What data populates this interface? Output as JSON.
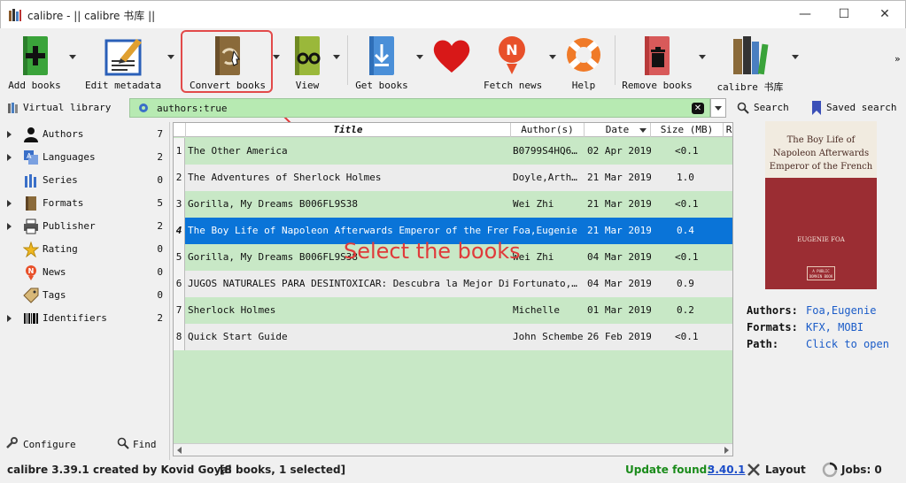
{
  "window": {
    "title": "calibre - || calibre 书库 ||",
    "minimize": "—",
    "maximize": "☐",
    "close": "✕"
  },
  "toolbar": {
    "add_books": "Add books",
    "edit_metadata": "Edit metadata",
    "convert_books": "Convert books",
    "view": "View",
    "get_books": "Get books",
    "fetch_news": "Fetch news",
    "help": "Help",
    "remove_books": "Remove books",
    "library": "calibre 书库",
    "more": "»"
  },
  "searchbar": {
    "virtual_library": "Virtual library",
    "query": "authors:true",
    "search": "Search",
    "saved_search": "Saved search"
  },
  "tag_browser": {
    "items": [
      {
        "label": "Authors",
        "count": "7",
        "expandable": true
      },
      {
        "label": "Languages",
        "count": "2",
        "expandable": true
      },
      {
        "label": "Series",
        "count": "0",
        "expandable": false
      },
      {
        "label": "Formats",
        "count": "5",
        "expandable": true
      },
      {
        "label": "Publisher",
        "count": "2",
        "expandable": true
      },
      {
        "label": "Rating",
        "count": "0",
        "expandable": false
      },
      {
        "label": "News",
        "count": "0",
        "expandable": false
      },
      {
        "label": "Tags",
        "count": "0",
        "expandable": false
      },
      {
        "label": "Identifiers",
        "count": "2",
        "expandable": true
      }
    ],
    "configure": "Configure",
    "find": "Find"
  },
  "book_table": {
    "columns": [
      "Title",
      "Author(s)",
      "Date",
      "Size (MB)",
      "R"
    ],
    "rows": [
      {
        "num": "1",
        "title": "The Other America",
        "author": "B0799S4HQ6…",
        "date": "02 Apr 2019",
        "size": "<0.1"
      },
      {
        "num": "2",
        "title": "The Adventures of Sherlock Holmes",
        "author": "Doyle,Arth…",
        "date": "21 Mar 2019",
        "size": "1.0"
      },
      {
        "num": "3",
        "title": "Gorilla, My Dreams B006FL9S38",
        "author": "Wei Zhi",
        "date": "21 Mar 2019",
        "size": "<0.1"
      },
      {
        "num": "4",
        "title": "The Boy Life of Napoleon Afterwards Emperor of the French",
        "author": "Foa,Eugenie",
        "date": "21 Mar 2019",
        "size": "0.4"
      },
      {
        "num": "5",
        "title": "Gorilla, My Dreams B006FL9S38",
        "author": "Wei Zhi",
        "date": "04 Mar 2019",
        "size": "<0.1"
      },
      {
        "num": "6",
        "title": "JUGOS NATURALES PARA DESINTOXICAR: Descubra la Mejor Dieta…",
        "author": "Fortunato,…",
        "date": "04 Mar 2019",
        "size": "0.9"
      },
      {
        "num": "7",
        "title": "Sherlock Holmes",
        "author": "Michelle",
        "date": "01 Mar 2019",
        "size": "0.2"
      },
      {
        "num": "8",
        "title": "Quick Start Guide",
        "author": "John Schember",
        "date": "26 Feb 2019",
        "size": "<0.1"
      }
    ],
    "selected_row": 4
  },
  "annotation": "Select the books",
  "cover": {
    "title": "The Boy Life of Napoleon Afterwards Emperor of the French",
    "author": "EUGENIE FOA",
    "plate": "A PUBLIC DOMAIN BOOK"
  },
  "details": {
    "authors_label": "Authors:",
    "authors_value": "Foa,Eugenie",
    "formats_label": "Formats:",
    "formats_value": "KFX, MOBI",
    "path_label": "Path:",
    "path_value": "Click to open"
  },
  "statusbar": {
    "version": "calibre 3.39.1 created by Kovid Goyal",
    "books": "[8 books, 1 selected]",
    "update_label": "Update found:",
    "update_version": "3.40.1",
    "layout": "Layout",
    "jobs": "Jobs: 0"
  },
  "colors": {
    "accent_red": "#e24a4a",
    "selection": "#0a74d8",
    "row_green": "#c8e8c6",
    "search_green": "#b7eab2",
    "link": "#1b5cc8"
  }
}
